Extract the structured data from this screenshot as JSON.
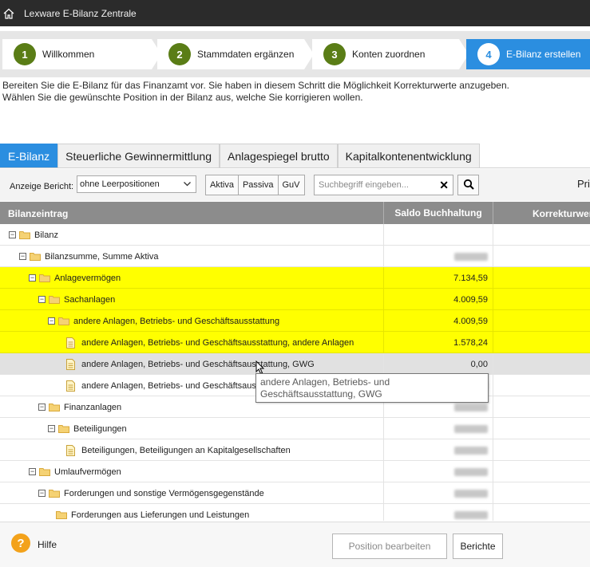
{
  "app": {
    "title": "Lexware E-Bilanz Zentrale"
  },
  "steps": [
    {
      "number": "1",
      "label": "Willkommen"
    },
    {
      "number": "2",
      "label": "Stammdaten ergänzen"
    },
    {
      "number": "3",
      "label": "Konten zuordnen"
    },
    {
      "number": "4",
      "label": "E-Bilanz erstellen"
    }
  ],
  "intro": {
    "line1": "Bereiten Sie die E-Bilanz für das Finanzamt vor. Sie haben in diesem Schritt die Möglichkeit Korrekturwerte anzugeben.",
    "line2": "Wählen Sie die gewünschte Position in der Bilanz aus, welche Sie korrigieren wollen."
  },
  "tabs": [
    "E-Bilanz",
    "Steuerliche Gewinnermittlung",
    "Anlagespiegel brutto",
    "Kapitalkontenentwicklung"
  ],
  "toolbar": {
    "report_label": "Anzeige Bericht:",
    "report_value": "ohne Leerpositionen",
    "aktiva": "Aktiva",
    "passiva": "Passiva",
    "guv": "GuV",
    "search_placeholder": "Suchbegriff eingeben...",
    "right_label": "Pri"
  },
  "grid": {
    "col_entry": "Bilanzeintrag",
    "col_saldo": "Saldo Buchhaltung",
    "col_korrektur": "Korrekturwert",
    "rows": [
      {
        "name": "Bilanz",
        "value": ""
      },
      {
        "name": "Bilanzsumme, Summe Aktiva",
        "value": ""
      },
      {
        "name": "Anlagevermögen",
        "value": "7.134,59"
      },
      {
        "name": "Sachanlagen",
        "value": "4.009,59"
      },
      {
        "name": "andere Anlagen, Betriebs- und Geschäftsausstattung",
        "value": "4.009,59"
      },
      {
        "name": "andere Anlagen, Betriebs- und Geschäftsausstattung, andere Anlagen",
        "value": "1.578,24"
      },
      {
        "name": "andere Anlagen, Betriebs- und Geschäftsausstattung, GWG",
        "value": "0,00"
      },
      {
        "name": "andere Anlagen, Betriebs- und Geschäftsausstattung, Sammelposten",
        "value": ""
      },
      {
        "name": "Finanzanlagen",
        "value": ""
      },
      {
        "name": "Beteiligungen",
        "value": ""
      },
      {
        "name": "Beteiligungen, Beteiligungen an Kapitalgesellschaften",
        "value": ""
      },
      {
        "name": "Umlaufvermögen",
        "value": ""
      },
      {
        "name": "Forderungen und sonstige Vermögensgegenstände",
        "value": ""
      },
      {
        "name": "Forderungen aus Lieferungen und Leistungen",
        "value": ""
      }
    ]
  },
  "tooltip": "andere Anlagen, Betriebs- und Geschäftsausstattung, GWG",
  "footer": {
    "help": "Hilfe",
    "edit_button": "Position bearbeiten",
    "reports_button": "Berichte"
  },
  "colors": {
    "accent": "#2b8ee0",
    "step_green": "#5a7d16",
    "highlight": "#ffff00",
    "help_orange": "#f3a21b"
  }
}
